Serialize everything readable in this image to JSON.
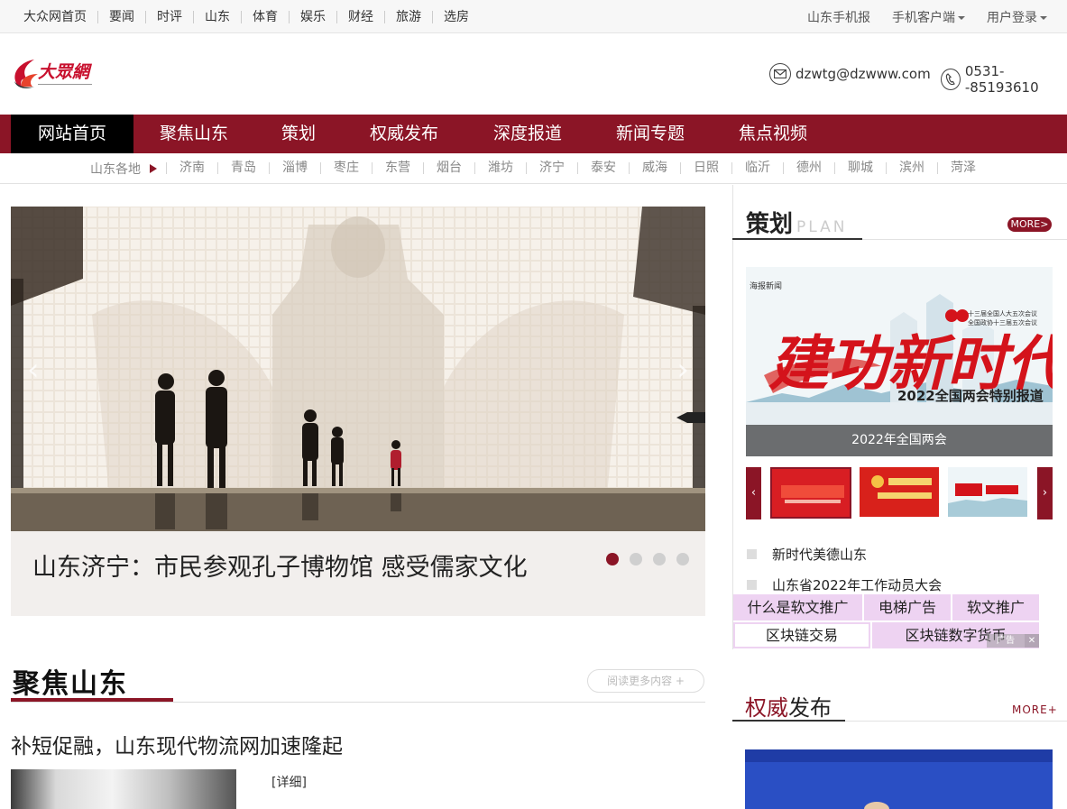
{
  "topbar": {
    "nav": [
      "大众网首页",
      "要闻",
      "时评",
      "山东",
      "体育",
      "娱乐",
      "财经",
      "旅游",
      "选房"
    ],
    "mobile_paper": "山东手机报",
    "mobile_client": "手机客户端",
    "login": "用户登录"
  },
  "header": {
    "email": "dzwtg@dzwww.com",
    "phone": "0531--85193610"
  },
  "mainnav": {
    "items": [
      "网站首页",
      "聚焦山东",
      "策划",
      "权威发布",
      "深度报道",
      "新闻专题",
      "焦点视频"
    ]
  },
  "subnav": {
    "label": "山东各地",
    "cities": [
      "济南",
      "青岛",
      "淄博",
      "枣庄",
      "东营",
      "烟台",
      "潍坊",
      "济宁",
      "泰安",
      "威海",
      "日照",
      "临沂",
      "德州",
      "聊城",
      "滨州",
      "菏泽"
    ]
  },
  "slider": {
    "caption": "山东济宁：市民参观孔子博物馆 感受儒家文化",
    "total_slides": 4,
    "active_slide": 1
  },
  "focus": {
    "title": "聚焦山东",
    "readmore": "阅读更多内容 +",
    "headline": "补短促融，山东现代物流网加速隆起",
    "detail": "[详细]"
  },
  "plan": {
    "title_cn": "策划",
    "title_en": "PLAN",
    "more": "MORE>",
    "banner_caption": "2022年全国两会",
    "banner_title": "建功新时代",
    "banner_sub": "2022全国两会特别报道",
    "banner_note1": "十三届全国人大五次会议",
    "banner_note2": "全国政协十三届五次会议",
    "banner_brand": "海报新闻",
    "list": [
      "新时代美德山东",
      "山东省2022年工作动员大会"
    ]
  },
  "ads": {
    "row1": [
      "什么是软文推广",
      "电梯广告",
      "软文推广"
    ],
    "row2": [
      "区块链交易",
      "区块链数字货币"
    ],
    "badge": "广告",
    "close": "✕"
  },
  "authority": {
    "title_red": "权威",
    "title_black": "发布",
    "more": "MORE+"
  },
  "colors": {
    "brand": "#8b1526",
    "nav_active": "#000000",
    "ad_bg": "#eed3f2"
  }
}
